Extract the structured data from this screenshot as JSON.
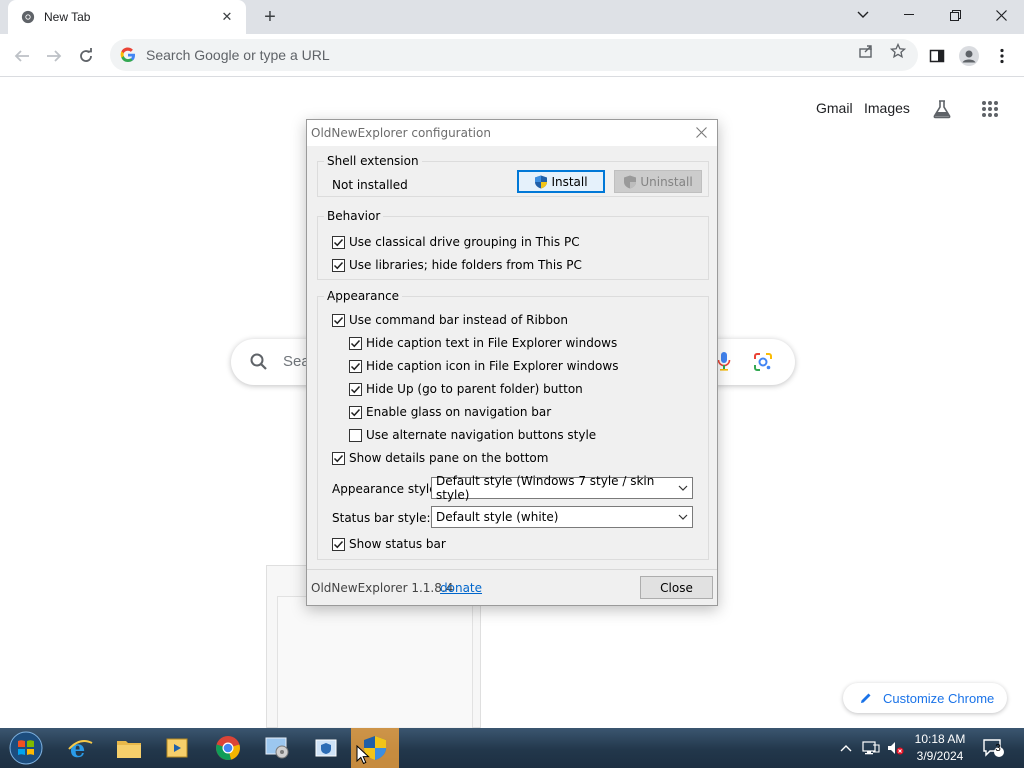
{
  "browser": {
    "tab_title": "New Tab",
    "omnibox_placeholder": "Search Google or type a URL"
  },
  "ntp": {
    "gmail_link": "Gmail",
    "images_link": "Images",
    "search_placeholder_visible": "Sea",
    "customize_label": "Customize Chrome"
  },
  "dialog": {
    "title": "OldNewExplorer configuration",
    "shell_extension": {
      "legend": "Shell extension",
      "status": "Not installed",
      "install_label": "Install",
      "uninstall_label": "Uninstall"
    },
    "behavior": {
      "legend": "Behavior",
      "options": [
        {
          "label": "Use classical drive grouping in This PC",
          "checked": true
        },
        {
          "label": "Use libraries; hide folders from This PC",
          "checked": true
        }
      ]
    },
    "appearance": {
      "legend": "Appearance",
      "options": [
        {
          "label": "Use command bar instead of Ribbon",
          "checked": true
        },
        {
          "label": "Hide caption text in File Explorer windows",
          "checked": true
        },
        {
          "label": "Hide caption icon in File Explorer windows",
          "checked": true
        },
        {
          "label": "Hide Up (go to parent folder) button",
          "checked": true
        },
        {
          "label": "Enable glass on navigation bar",
          "checked": true
        },
        {
          "label": "Use alternate navigation buttons style",
          "checked": false
        },
        {
          "label": "Show details pane on the bottom",
          "checked": true
        }
      ],
      "appearance_style_label": "Appearance style:",
      "appearance_style_value": "Default style (Windows 7 style / skin style)",
      "status_bar_style_label": "Status bar style:",
      "status_bar_style_value": "Default style (white)",
      "show_status_bar": {
        "label": "Show status bar",
        "checked": true
      }
    },
    "footer": {
      "version": "OldNewExplorer 1.1.8.4",
      "donate_label": "donate",
      "close_label": "Close"
    }
  },
  "taskbar": {
    "time": "10:18 AM",
    "date": "3/9/2024",
    "notification_count": "3"
  }
}
